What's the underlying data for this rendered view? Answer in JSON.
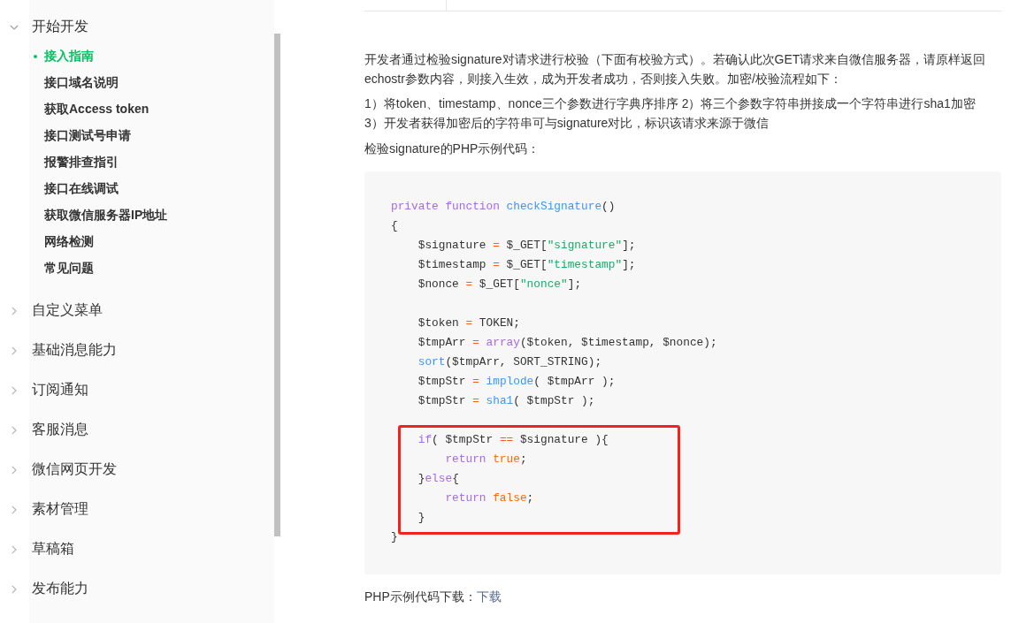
{
  "sidebar": {
    "sections": [
      {
        "label": "开始开发",
        "expanded": true,
        "children": [
          {
            "label": "接入指南",
            "selected": true
          },
          {
            "label": "接口域名说明",
            "selected": false
          },
          {
            "label": "获取Access token",
            "selected": false
          },
          {
            "label": "接口测试号申请",
            "selected": false
          },
          {
            "label": "报警排查指引",
            "selected": false
          },
          {
            "label": "接口在线调试",
            "selected": false
          },
          {
            "label": "获取微信服务器IP地址",
            "selected": false
          },
          {
            "label": "网络检测",
            "selected": false
          },
          {
            "label": "常见问题",
            "selected": false
          }
        ]
      },
      {
        "label": "自定义菜单",
        "expanded": false
      },
      {
        "label": "基础消息能力",
        "expanded": false
      },
      {
        "label": "订阅通知",
        "expanded": false
      },
      {
        "label": "客服消息",
        "expanded": false
      },
      {
        "label": "微信网页开发",
        "expanded": false
      },
      {
        "label": "素材管理",
        "expanded": false
      },
      {
        "label": "草稿箱",
        "expanded": false
      },
      {
        "label": "发布能力",
        "expanded": false
      }
    ]
  },
  "content": {
    "paragraphs": [
      "开发者通过检验signature对请求进行校验（下面有校验方式）。若确认此次GET请求来自微信服务器，请原样返回echostr参数内容，则接入生效，成为开发者成功，否则接入失败。加密/校验流程如下：",
      "1）将token、timestamp、nonce三个参数进行字典序排序 2）将三个参数字符串拼接成一个字符串进行sha1加密 3）开发者获得加密后的字符串可与signature对比，标识该请求来源于微信",
      "检验signature的PHP示例代码："
    ],
    "code": {
      "blocks": [
        {
          "kind": "plain",
          "lines": [
            {
              "kind": "code",
              "tokens": [
                {
                  "kind": "keyword",
                  "text": "private"
                },
                {
                  "kind": "keyword",
                  "text": " function"
                },
                {
                  "kind": "function",
                  "text": " checkSignature"
                },
                {
                  "kind": "plain",
                  "text": "()"
                }
              ]
            },
            {
              "kind": "code",
              "tokens": [
                {
                  "kind": "plain",
                  "text": "{"
                }
              ]
            },
            {
              "kind": "code",
              "tokens": [
                {
                  "kind": "plain",
                  "text": "    $signature "
                },
                {
                  "kind": "operator",
                  "text": "="
                },
                {
                  "kind": "plain",
                  "text": " $_GET["
                },
                {
                  "kind": "string",
                  "text": "\"signature\""
                },
                {
                  "kind": "plain",
                  "text": "];"
                }
              ]
            },
            {
              "kind": "code",
              "tokens": [
                {
                  "kind": "plain",
                  "text": "    $timestamp "
                },
                {
                  "kind": "operator",
                  "text": "="
                },
                {
                  "kind": "plain",
                  "text": " $_GET["
                },
                {
                  "kind": "string",
                  "text": "\"timestamp\""
                },
                {
                  "kind": "plain",
                  "text": "];"
                }
              ]
            },
            {
              "kind": "code",
              "tokens": [
                {
                  "kind": "plain",
                  "text": "    $nonce "
                },
                {
                  "kind": "operator",
                  "text": "="
                },
                {
                  "kind": "plain",
                  "text": " $_GET["
                },
                {
                  "kind": "string",
                  "text": "\"nonce\""
                },
                {
                  "kind": "plain",
                  "text": "];"
                }
              ]
            },
            {
              "kind": "blank"
            },
            {
              "kind": "code",
              "tokens": [
                {
                  "kind": "plain",
                  "text": "    $token "
                },
                {
                  "kind": "operator",
                  "text": "="
                },
                {
                  "kind": "plain",
                  "text": " TOKEN;"
                }
              ]
            },
            {
              "kind": "code",
              "tokens": [
                {
                  "kind": "plain",
                  "text": "    $tmpArr "
                },
                {
                  "kind": "operator",
                  "text": "="
                },
                {
                  "kind": "keyword",
                  "text": " array"
                },
                {
                  "kind": "plain",
                  "text": "($token, $timestamp, $nonce);"
                }
              ]
            },
            {
              "kind": "code",
              "tokens": [
                {
                  "kind": "function",
                  "text": "    sort"
                },
                {
                  "kind": "plain",
                  "text": "($tmpArr, SORT_STRING);"
                }
              ]
            },
            {
              "kind": "code",
              "tokens": [
                {
                  "kind": "plain",
                  "text": "    $tmpStr "
                },
                {
                  "kind": "operator",
                  "text": "="
                },
                {
                  "kind": "function",
                  "text": " implode"
                },
                {
                  "kind": "plain",
                  "text": "( $tmpArr );"
                }
              ]
            },
            {
              "kind": "code",
              "tokens": [
                {
                  "kind": "plain",
                  "text": "    $tmpStr "
                },
                {
                  "kind": "operator",
                  "text": "="
                },
                {
                  "kind": "function",
                  "text": " sha1"
                },
                {
                  "kind": "plain",
                  "text": "( $tmpStr );"
                }
              ]
            },
            {
              "kind": "blank"
            }
          ]
        },
        {
          "kind": "highlighted",
          "lines": [
            {
              "kind": "code",
              "tokens": [
                {
                  "kind": "keyword",
                  "text": "    if"
                },
                {
                  "kind": "plain",
                  "text": "( $tmpStr "
                },
                {
                  "kind": "operator",
                  "text": "=="
                },
                {
                  "kind": "plain",
                  "text": " $signature ){"
                }
              ]
            },
            {
              "kind": "code",
              "tokens": [
                {
                  "kind": "keyword",
                  "text": "        return"
                },
                {
                  "kind": "literal",
                  "text": " true"
                },
                {
                  "kind": "plain",
                  "text": ";"
                }
              ]
            },
            {
              "kind": "code",
              "tokens": [
                {
                  "kind": "plain",
                  "text": "    }"
                },
                {
                  "kind": "keyword",
                  "text": "else"
                },
                {
                  "kind": "plain",
                  "text": "{"
                }
              ]
            },
            {
              "kind": "code",
              "tokens": [
                {
                  "kind": "keyword",
                  "text": "        return"
                },
                {
                  "kind": "literal",
                  "text": " false"
                },
                {
                  "kind": "plain",
                  "text": ";"
                }
              ]
            },
            {
              "kind": "code",
              "tokens": [
                {
                  "kind": "plain",
                  "text": "    }"
                }
              ]
            }
          ]
        },
        {
          "kind": "plain",
          "lines": [
            {
              "kind": "code",
              "tokens": [
                {
                  "kind": "plain",
                  "text": "}"
                }
              ]
            }
          ]
        }
      ]
    },
    "download": {
      "label": "PHP示例代码下载：",
      "link": "下载"
    }
  }
}
